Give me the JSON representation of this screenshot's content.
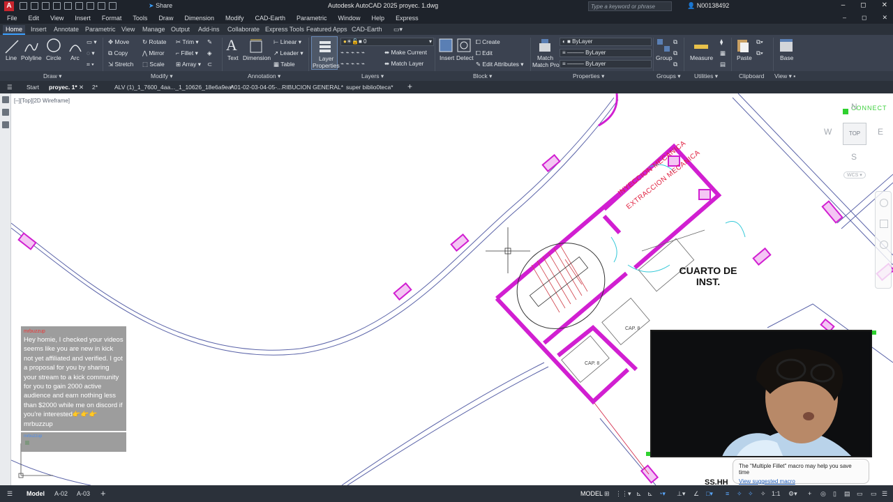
{
  "titlebar": {
    "app_title": "Autodesk AutoCAD 2025   proyec. 1.dwg",
    "share": "Share",
    "search_placeholder": "Type a keyword or phrase",
    "user": "N00138492",
    "min": "–",
    "max": "◻",
    "close": "✕"
  },
  "menubar": {
    "items": [
      "File",
      "Edit",
      "View",
      "Insert",
      "Format",
      "Tools",
      "Draw",
      "Dimension",
      "Modify",
      "CAD-Earth",
      "Parametric",
      "Window",
      "Help",
      "Express"
    ]
  },
  "ribbon_tabs": [
    "Home",
    "Insert",
    "Annotate",
    "Parametric",
    "View",
    "Manage",
    "Output",
    "Add-ins",
    "Collaborate",
    "Express Tools",
    "Featured Apps",
    "CAD-Earth"
  ],
  "ribbon": {
    "draw": {
      "line": "Line",
      "polyline": "Polyline",
      "circle": "Circle",
      "arc": "Arc",
      "title": "Draw"
    },
    "modify": {
      "move": "Move",
      "rotate": "Rotate",
      "trim": "Trim",
      "copy": "Copy",
      "mirror": "Mirror",
      "fillet": "Fillet",
      "stretch": "Stretch",
      "scale": "Scale",
      "array": "Array",
      "title": "Modify"
    },
    "annotation": {
      "text": "Text",
      "dimension": "Dimension",
      "linear": "Linear",
      "leader": "Leader",
      "table": "Table",
      "title": "Annotation"
    },
    "layers": {
      "layer_properties": "Layer Properties",
      "layer_value": "0",
      "make_current": "Make Current",
      "match_layer": "Match Layer",
      "title": "Layers"
    },
    "block": {
      "insert": "Insert",
      "detect": "Detect",
      "create": "Create",
      "edit": "Edit",
      "edit_attributes": "Edit Attributes",
      "title": "Block"
    },
    "properties": {
      "match_properties": "Match Properties",
      "bylayer1": "ByLayer",
      "bylayer2": "ByLayer",
      "bylayer3": "ByLayer",
      "title": "Properties"
    },
    "groups": {
      "group": "Group",
      "title": "Groups"
    },
    "utilities": {
      "measure": "Measure",
      "title": "Utilities"
    },
    "clipboard": {
      "paste": "Paste",
      "title": "Clipboard"
    },
    "view": {
      "base": "Base",
      "title": "View"
    }
  },
  "doc_tabs": [
    "Start",
    "proyec. 1*",
    "2*",
    "ALV (1)_1_7600_4aa..._1_10626_18e6a9ea*",
    "A01-02-03-04-05-...RIBUCION GENERAL*",
    "super biblio0teca*"
  ],
  "canvas": {
    "view_label": "[–][Top][2D Wireframe]",
    "room_label_1": "CUARTO DE",
    "room_label_2": "INST.",
    "inyeccion": "INYECCION  MECANICA",
    "extraccion": "EXTRACCION  MECANICA",
    "cap1": "CAP. 8",
    "cap2": "CAP. 8",
    "ssh": "SS.HH",
    "connect": "CONNECT"
  },
  "viewcube": {
    "top": "TOP",
    "w": "W",
    "e": "E",
    "s": "S",
    "n": "N",
    "wcs": "WCS"
  },
  "chat": {
    "author": "mrbuzzup",
    "message": "Hey homie, I checked your videos seems like you are new in kick not yet affiliated and verified. I got a proposal for you by sharing your stream to a kick community for you to gain 2000 active audience and earn nothing less than $2000 while me on discord if you're interested👉👉👉 mrbuzzup",
    "author2": "mrbuzzup"
  },
  "tooltip": {
    "text": "The \"Multiple Fillet\" macro may help you save time",
    "link": "View suggested macro"
  },
  "statusbar": {
    "model_tab": "Model",
    "layout1": "A-02",
    "layout2": "A-03",
    "model_btn": "MODEL",
    "scale": "1:1"
  }
}
